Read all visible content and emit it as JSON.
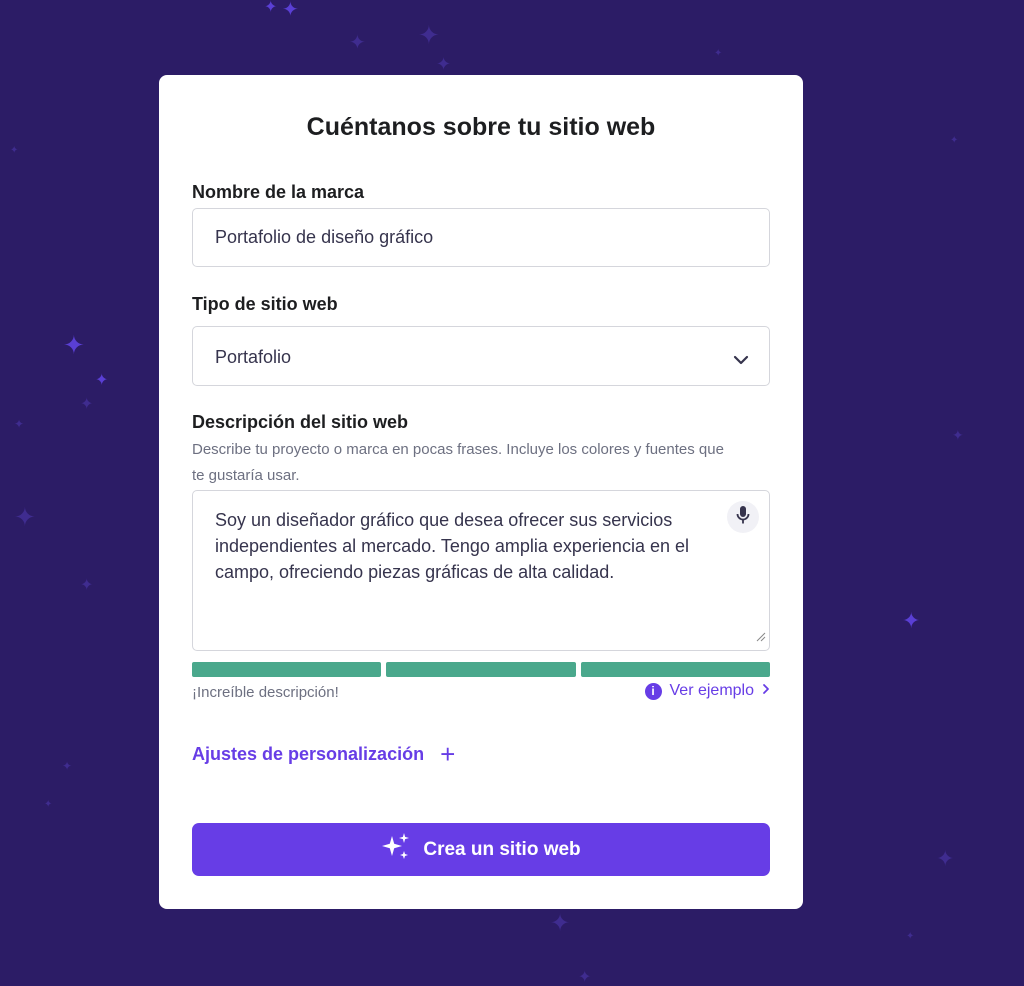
{
  "form": {
    "title": "Cuéntanos sobre tu sitio web",
    "brand": {
      "label": "Nombre de la marca",
      "value": "Portafolio de diseño gráfico"
    },
    "site_type": {
      "label": "Tipo de sitio web",
      "selected": "Portafolio"
    },
    "description": {
      "label": "Descripción del sitio web",
      "helper": "Describe tu proyecto o marca en pocas frases. Incluye los colores y fuentes que te gustaría usar.",
      "value": "Soy un diseñador gráfico que desea ofrecer sus servicios independientes al mercado. Tengo amplia experiencia en el campo, ofreciendo piezas gráficas de alta calidad.",
      "quality_segments_filled": 3,
      "quality_segments_total": 3,
      "feedback": "¡Increíble descripción!",
      "example_link": "Ver ejemplo"
    },
    "customization": {
      "label": "Ajustes de personalización"
    },
    "submit_label": "Crea un sitio web"
  },
  "colors": {
    "background": "#2c1c66",
    "accent": "#673de6",
    "success": "#4aa88c"
  },
  "icons": [
    "sparkle-icon",
    "chevron-down-icon",
    "microphone-icon",
    "info-icon",
    "chevron-right-icon",
    "plus-icon",
    "resize-handle-icon"
  ]
}
